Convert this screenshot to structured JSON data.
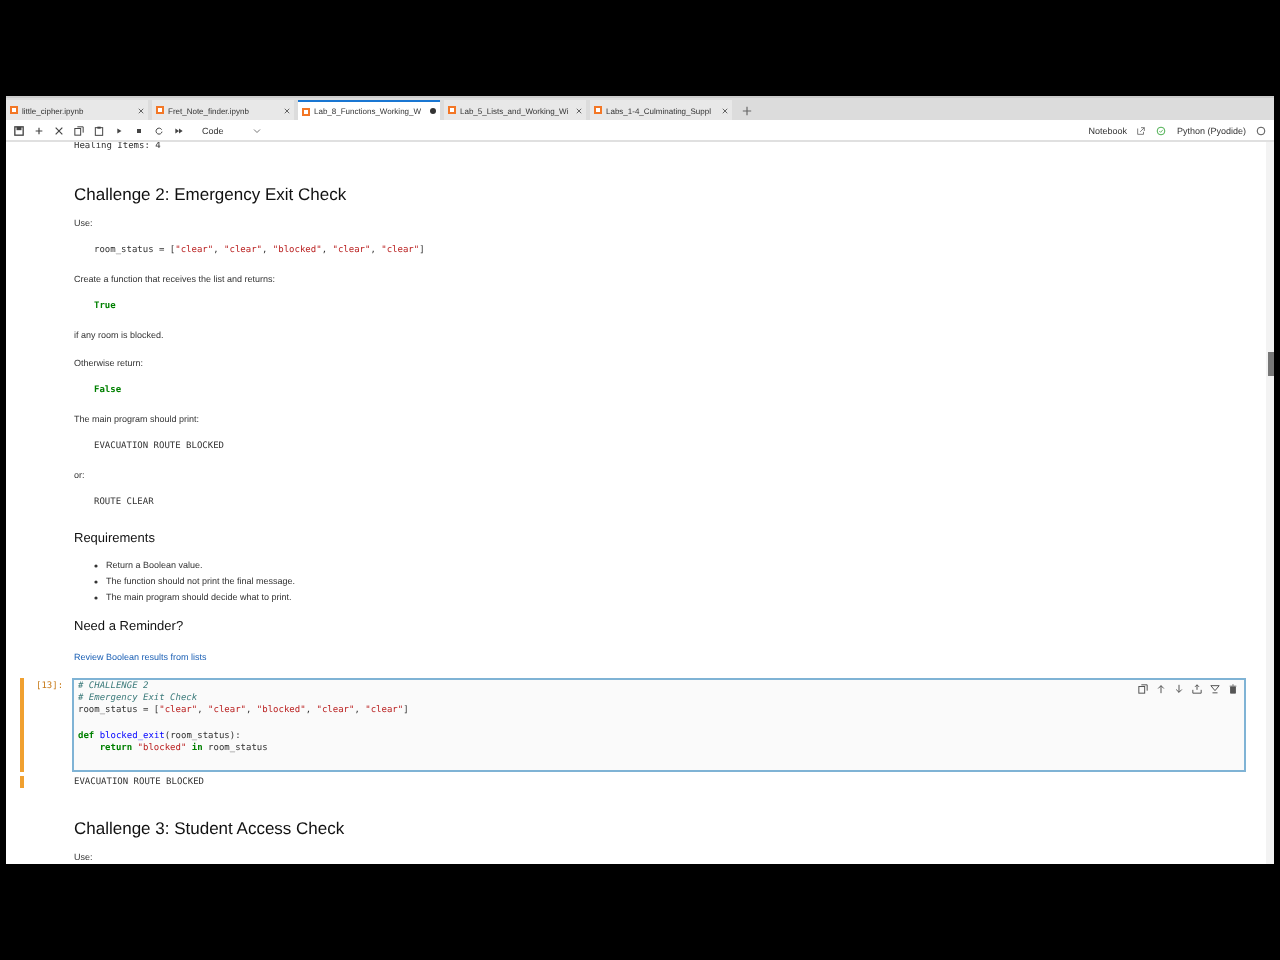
{
  "tabs": [
    {
      "label": "little_cipher.ipynb",
      "selected": false,
      "dirty": false
    },
    {
      "label": "Fret_Note_finder.ipynb",
      "selected": false,
      "dirty": false
    },
    {
      "label": "Lab_8_Functions_Working_W",
      "selected": true,
      "dirty": true
    },
    {
      "label": "Lab_5_Lists_and_Working_Wi",
      "selected": false,
      "dirty": false
    },
    {
      "label": "Labs_1-4_Culminating_Suppl",
      "selected": false,
      "dirty": false
    }
  ],
  "toolbar": {
    "cell_type": "Code",
    "notebook_label": "Notebook",
    "kernel": "Python (Pyodide)"
  },
  "notebook": {
    "blocks": [
      {
        "kind": "output",
        "text": "Healing Items: 4"
      },
      {
        "kind": "h2",
        "text": "Challenge 2: Emergency Exit Check"
      },
      {
        "kind": "p",
        "text": "Use:"
      },
      {
        "kind": "code",
        "tokens": [
          {
            "kind": "plain",
            "text": "room_status = ["
          },
          {
            "kind": "string",
            "text": "\"clear\""
          },
          {
            "kind": "plain",
            "text": ", "
          },
          {
            "kind": "string",
            "text": "\"clear\""
          },
          {
            "kind": "plain",
            "text": ", "
          },
          {
            "kind": "string",
            "text": "\"blocked\""
          },
          {
            "kind": "plain",
            "text": ", "
          },
          {
            "kind": "string",
            "text": "\"clear\""
          },
          {
            "kind": "plain",
            "text": ", "
          },
          {
            "kind": "string",
            "text": "\"clear\""
          },
          {
            "kind": "plain",
            "text": "]"
          }
        ]
      },
      {
        "kind": "p",
        "text": "Create a function that receives the list and returns:"
      },
      {
        "kind": "code",
        "tokens": [
          {
            "kind": "keyword",
            "text": "True"
          }
        ]
      },
      {
        "kind": "p",
        "text": "if any room is blocked."
      },
      {
        "kind": "p",
        "text": "Otherwise return:"
      },
      {
        "kind": "code",
        "tokens": [
          {
            "kind": "keyword",
            "text": "False"
          }
        ]
      },
      {
        "kind": "p",
        "text": "The main program should print:"
      },
      {
        "kind": "code",
        "tokens": [
          {
            "kind": "plain",
            "text": "EVACUATION ROUTE BLOCKED"
          }
        ]
      },
      {
        "kind": "p",
        "text": "or:"
      },
      {
        "kind": "code",
        "tokens": [
          {
            "kind": "plain",
            "text": "ROUTE CLEAR"
          }
        ]
      },
      {
        "kind": "h3",
        "text": "Requirements"
      },
      {
        "kind": "list",
        "items": [
          "Return a Boolean value.",
          "The function should not print the final message.",
          "The main program should decide what to print."
        ]
      },
      {
        "kind": "h3",
        "text": "Need a Reminder?"
      },
      {
        "kind": "link",
        "text": "Review Boolean results from lists"
      },
      {
        "kind": "code_cell",
        "prompt": "[13]:",
        "active": true,
        "lines": [
          {
            "kind": "code",
            "tokens": [
              {
                "kind": "comment",
                "text": "# CHALLENGE 2"
              }
            ]
          },
          {
            "kind": "code",
            "tokens": [
              {
                "kind": "comment",
                "text": "# Emergency Exit Check"
              }
            ]
          },
          {
            "kind": "code",
            "tokens": [
              {
                "kind": "plain",
                "text": "room_status = ["
              },
              {
                "kind": "string",
                "text": "\"clear\""
              },
              {
                "kind": "plain",
                "text": ", "
              },
              {
                "kind": "string",
                "text": "\"clear\""
              },
              {
                "kind": "plain",
                "text": ", "
              },
              {
                "kind": "string",
                "text": "\"blocked\""
              },
              {
                "kind": "plain",
                "text": ", "
              },
              {
                "kind": "string",
                "text": "\"clear\""
              },
              {
                "kind": "plain",
                "text": ", "
              },
              {
                "kind": "string",
                "text": "\"clear\""
              },
              {
                "kind": "plain",
                "text": "]"
              }
            ]
          },
          {
            "kind": "blank"
          },
          {
            "kind": "code",
            "tokens": [
              {
                "kind": "keyword",
                "text": "def"
              },
              {
                "kind": "def",
                "text": " blocked_exit"
              },
              {
                "kind": "plain",
                "text": "(room_status):"
              }
            ]
          },
          {
            "kind": "code",
            "tokens": [
              {
                "kind": "keyword",
                "text": "    return"
              },
              {
                "kind": "string",
                "text": " \"blocked\""
              },
              {
                "kind": "keyword",
                "text": " in"
              },
              {
                "kind": "plain",
                "text": " room_status"
              }
            ]
          }
        ]
      },
      {
        "kind": "cell_output",
        "text": "EVACUATION ROUTE BLOCKED"
      },
      {
        "kind": "h2",
        "text": "Challenge 3: Student Access Check"
      },
      {
        "kind": "p",
        "text": "Use:"
      }
    ]
  }
}
